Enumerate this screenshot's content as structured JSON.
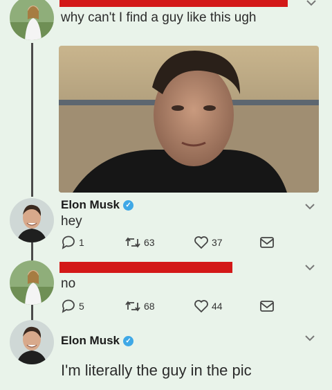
{
  "tweet1": {
    "text": "why can't I find a guy like this ugh"
  },
  "tweet2": {
    "name": "Elon Musk",
    "text": "hey",
    "replies": "1",
    "retweets": "63",
    "likes": "37"
  },
  "tweet3": {
    "text": "no",
    "replies": "5",
    "retweets": "68",
    "likes": "44"
  },
  "tweet4": {
    "name": "Elon Musk",
    "text": "I'm literally the guy in the pic"
  },
  "colors": {
    "background": "#e9f3ea",
    "redaction": "#d31818",
    "verified": "#3fa8e6"
  },
  "icons": [
    "chevron-down-icon",
    "reply-icon",
    "retweet-icon",
    "like-icon",
    "message-icon",
    "verified-badge-icon"
  ]
}
